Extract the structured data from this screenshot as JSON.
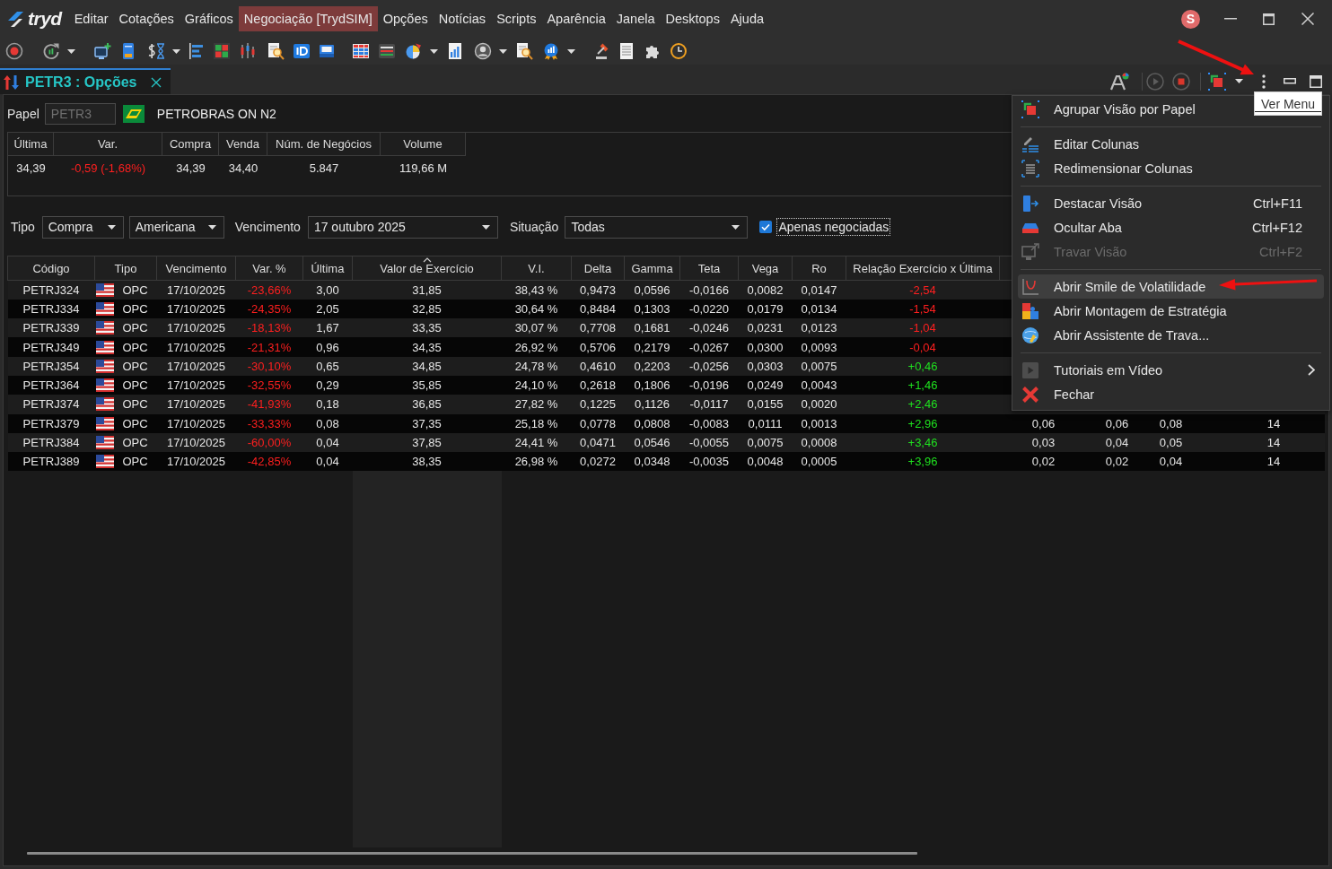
{
  "app": {
    "logo": "tryd",
    "menu_bar": [
      {
        "label": "Editar",
        "selected": false
      },
      {
        "label": "Cotações",
        "selected": false
      },
      {
        "label": "Gráficos",
        "selected": false
      },
      {
        "label": "Negociação [TrydSIM]",
        "selected": true
      },
      {
        "label": "Opções",
        "selected": false
      },
      {
        "label": "Notícias",
        "selected": false
      },
      {
        "label": "Scripts",
        "selected": false
      },
      {
        "label": "Aparência",
        "selected": false
      },
      {
        "label": "Janela",
        "selected": false
      },
      {
        "label": "Desktops",
        "selected": false
      },
      {
        "label": "Ajuda",
        "selected": false
      }
    ],
    "user_badge": "S"
  },
  "tabs": [
    {
      "label": "PETR3 : Opções",
      "selected": true
    }
  ],
  "tooltip": {
    "text": "Ver Menu"
  },
  "papel": {
    "label": "Papel",
    "value": "PETR3",
    "disabled": true,
    "description": "PETROBRAS ON N2"
  },
  "quote": {
    "columns": [
      "Última",
      "Var.",
      "Compra",
      "Venda",
      "Núm. de Negócios",
      "Volume"
    ],
    "last": "34,39",
    "change": {
      "text": "-0,59 (-1,68%)",
      "falling": true
    },
    "bid": "34,39",
    "ask": "34,40",
    "trades": "5.847",
    "volume": "119,66 M"
  },
  "filters": {
    "type": {
      "label": "Tipo",
      "value": "Compra"
    },
    "style": {
      "value": "Americana"
    },
    "expiry": {
      "label": "Vencimento",
      "value": "17 outubro 2025"
    },
    "status": {
      "label": "Situação",
      "value": "Todas"
    },
    "only_traded": {
      "label": "Apenas negociadas",
      "checked": true,
      "focused": true
    }
  },
  "table": {
    "columns": [
      {
        "label": "Código",
        "sorted": false
      },
      {
        "label": "Tipo",
        "sorted": false
      },
      {
        "label": "Vencimento",
        "sorted": false
      },
      {
        "label": "Var. %",
        "sorted": false
      },
      {
        "label": "Última",
        "sorted": false
      },
      {
        "label": "Valor de Exercício",
        "sorted": true
      },
      {
        "label": "V.I.",
        "sorted": false
      },
      {
        "label": "Delta",
        "sorted": false
      },
      {
        "label": "Gamma",
        "sorted": false
      },
      {
        "label": "Teta",
        "sorted": false
      },
      {
        "label": "Vega",
        "sorted": false
      },
      {
        "label": "Ro",
        "sorted": false
      },
      {
        "label": "Relação Exercício x Última",
        "sorted": false
      }
    ],
    "rows": [
      {
        "code": "PETRJ324",
        "type": "OPC",
        "expiry": "17/10/2025",
        "change": {
          "text": "-23,66%",
          "falling": true
        },
        "last": "3,00",
        "strike": "31,85",
        "iv": "38,43 %",
        "delta": "0,9473",
        "gamma": "0,0596",
        "theta": "-0,0166",
        "vega": "0,0082",
        "rho": "0,0147",
        "ratio": {
          "text": "-2,54",
          "falling": true
        }
      },
      {
        "code": "PETRJ334",
        "type": "OPC",
        "expiry": "17/10/2025",
        "change": {
          "text": "-24,35%",
          "falling": true
        },
        "last": "2,05",
        "strike": "32,85",
        "iv": "30,64 %",
        "delta": "0,8484",
        "gamma": "0,1303",
        "theta": "-0,0220",
        "vega": "0,0179",
        "rho": "0,0134",
        "ratio": {
          "text": "-1,54",
          "falling": true
        }
      },
      {
        "code": "PETRJ339",
        "type": "OPC",
        "expiry": "17/10/2025",
        "change": {
          "text": "-18,13%",
          "falling": true
        },
        "last": "1,67",
        "strike": "33,35",
        "iv": "30,07 %",
        "delta": "0,7708",
        "gamma": "0,1681",
        "theta": "-0,0246",
        "vega": "0,0231",
        "rho": "0,0123",
        "ratio": {
          "text": "-1,04",
          "falling": true
        }
      },
      {
        "code": "PETRJ349",
        "type": "OPC",
        "expiry": "17/10/2025",
        "change": {
          "text": "-21,31%",
          "falling": true
        },
        "last": "0,96",
        "strike": "34,35",
        "iv": "26,92 %",
        "delta": "0,5706",
        "gamma": "0,2179",
        "theta": "-0,0267",
        "vega": "0,0300",
        "rho": "0,0093",
        "ratio": {
          "text": "-0,04",
          "falling": true
        }
      },
      {
        "code": "PETRJ354",
        "type": "OPC",
        "expiry": "17/10/2025",
        "change": {
          "text": "-30,10%",
          "falling": true
        },
        "last": "0,65",
        "strike": "34,85",
        "iv": "24,78 %",
        "delta": "0,4610",
        "gamma": "0,2203",
        "theta": "-0,0256",
        "vega": "0,0303",
        "rho": "0,0075",
        "ratio": {
          "text": "+0,46",
          "falling": false
        }
      },
      {
        "code": "PETRJ364",
        "type": "OPC",
        "expiry": "17/10/2025",
        "change": {
          "text": "-32,55%",
          "falling": true
        },
        "last": "0,29",
        "strike": "35,85",
        "iv": "24,10 %",
        "delta": "0,2618",
        "gamma": "0,1806",
        "theta": "-0,0196",
        "vega": "0,0249",
        "rho": "0,0043",
        "ratio": {
          "text": "+1,46",
          "falling": false
        }
      },
      {
        "code": "PETRJ374",
        "type": "OPC",
        "expiry": "17/10/2025",
        "change": {
          "text": "-41,93%",
          "falling": true
        },
        "last": "0,18",
        "strike": "36,85",
        "iv": "27,82 %",
        "delta": "0,1225",
        "gamma": "0,1126",
        "theta": "-0,0117",
        "vega": "0,0155",
        "rho": "0,0020",
        "ratio": {
          "text": "+2,46",
          "falling": false
        }
      },
      {
        "code": "PETRJ379",
        "type": "OPC",
        "expiry": "17/10/2025",
        "change": {
          "text": "-33,33%",
          "falling": true
        },
        "last": "0,08",
        "strike": "37,35",
        "iv": "25,18 %",
        "delta": "0,0778",
        "gamma": "0,0808",
        "theta": "-0,0083",
        "vega": "0,0111",
        "rho": "0,0013",
        "ratio": {
          "text": "+2,96",
          "falling": false
        },
        "more": [
          "0,06",
          "0,06",
          "0,08",
          "14"
        ]
      },
      {
        "code": "PETRJ384",
        "type": "OPC",
        "expiry": "17/10/2025",
        "change": {
          "text": "-60,00%",
          "falling": true
        },
        "last": "0,04",
        "strike": "37,85",
        "iv": "24,41 %",
        "delta": "0,0471",
        "gamma": "0,0546",
        "theta": "-0,0055",
        "vega": "0,0075",
        "rho": "0,0008",
        "ratio": {
          "text": "+3,46",
          "falling": false
        },
        "more": [
          "0,03",
          "0,04",
          "0,05",
          "14"
        ]
      },
      {
        "code": "PETRJ389",
        "type": "OPC",
        "expiry": "17/10/2025",
        "change": {
          "text": "-42,85%",
          "falling": true
        },
        "last": "0,04",
        "strike": "38,35",
        "iv": "26,98 %",
        "delta": "0,0272",
        "gamma": "0,0348",
        "theta": "-0,0035",
        "vega": "0,0048",
        "rho": "0,0005",
        "ratio": {
          "text": "+3,96",
          "falling": false
        },
        "more": [
          "0,02",
          "0,02",
          "0,04",
          "14"
        ]
      }
    ]
  },
  "context_menu": {
    "sections": [
      {
        "items": [
          {
            "label": "Agrupar Visão por Papel",
            "disabled": false,
            "highlighted": false,
            "submenu": false
          }
        ]
      },
      {
        "items": [
          {
            "label": "Editar Colunas",
            "disabled": false,
            "highlighted": false,
            "submenu": false
          },
          {
            "label": "Redimensionar Colunas",
            "disabled": false,
            "highlighted": false,
            "submenu": false
          }
        ]
      },
      {
        "items": [
          {
            "label": "Destacar Visão",
            "shortcut": "Ctrl+F11",
            "disabled": false,
            "highlighted": false,
            "submenu": false
          },
          {
            "label": "Ocultar Aba",
            "shortcut": "Ctrl+F12",
            "disabled": false,
            "highlighted": false,
            "submenu": false
          },
          {
            "label": "Travar Visão",
            "shortcut": "Ctrl+F2",
            "disabled": true,
            "highlighted": false,
            "submenu": false
          }
        ]
      },
      {
        "items": [
          {
            "label": "Abrir Smile de Volatilidade",
            "disabled": false,
            "highlighted": true,
            "submenu": false
          },
          {
            "label": "Abrir Montagem de Estratégia",
            "disabled": false,
            "highlighted": false,
            "submenu": false
          },
          {
            "label": "Abrir Assistente de Trava...",
            "disabled": false,
            "highlighted": false,
            "submenu": false
          }
        ]
      },
      {
        "items": [
          {
            "label": "Tutoriais em Vídeo",
            "disabled": false,
            "highlighted": false,
            "submenu": true
          },
          {
            "label": "Fechar",
            "disabled": false,
            "highlighted": false,
            "submenu": false
          }
        ]
      }
    ]
  }
}
